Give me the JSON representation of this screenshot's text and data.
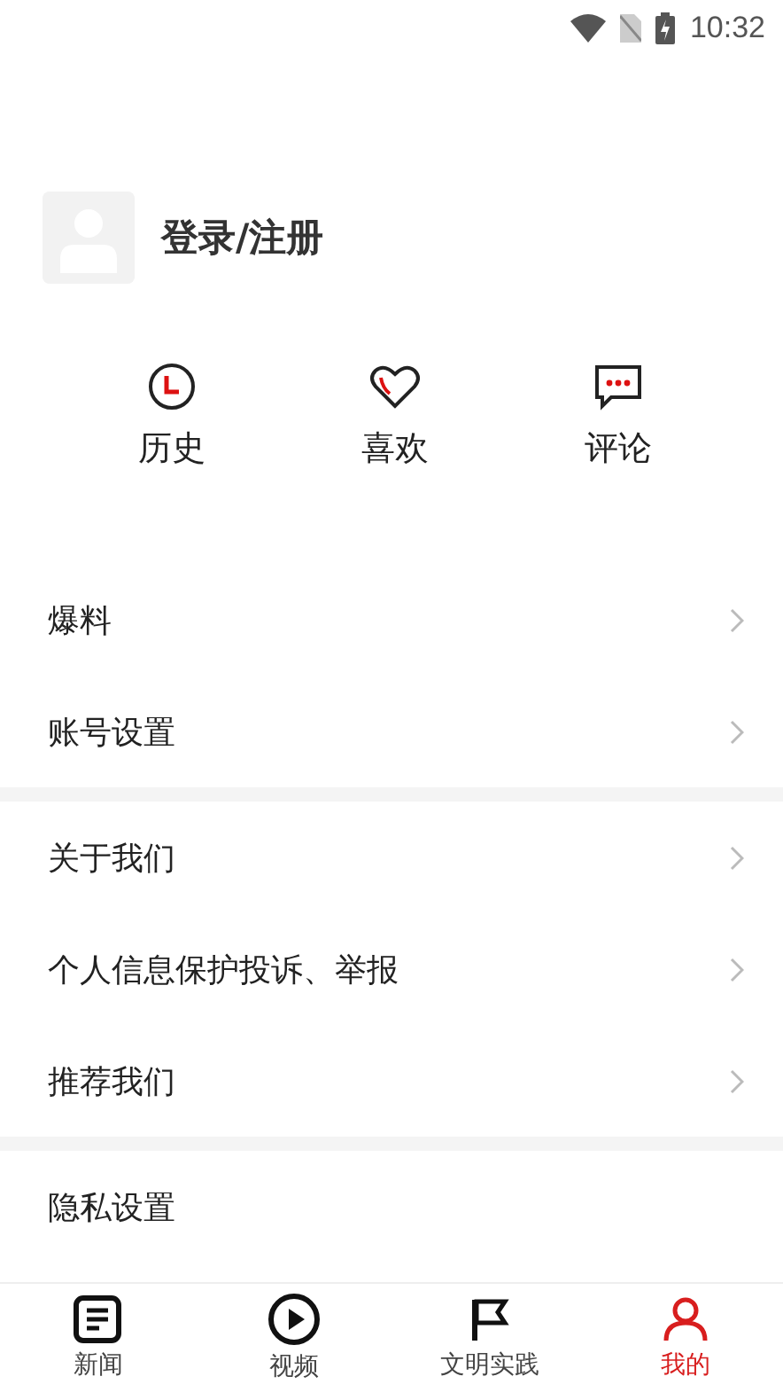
{
  "status_bar": {
    "time": "10:32"
  },
  "profile": {
    "login_label": "登录/注册"
  },
  "quick_actions": [
    {
      "kind": "history",
      "label": "历史"
    },
    {
      "kind": "like",
      "label": "喜欢"
    },
    {
      "kind": "comment",
      "label": "评论"
    }
  ],
  "menu_groups": [
    {
      "items": [
        {
          "label": "爆料",
          "has_arrow": true
        },
        {
          "label": "账号设置",
          "has_arrow": true
        }
      ]
    },
    {
      "items": [
        {
          "label": "关于我们",
          "has_arrow": true
        },
        {
          "label": "个人信息保护投诉、举报",
          "has_arrow": true
        },
        {
          "label": "推荐我们",
          "has_arrow": true
        }
      ]
    },
    {
      "items": [
        {
          "label": "隐私设置",
          "has_arrow": false
        }
      ]
    }
  ],
  "bottom_nav": [
    {
      "kind": "news",
      "label": "新闻",
      "selected": false
    },
    {
      "kind": "video",
      "label": "视频",
      "selected": false
    },
    {
      "kind": "practice",
      "label": "文明实践",
      "selected": false
    },
    {
      "kind": "mine",
      "label": "我的",
      "selected": true
    }
  ]
}
